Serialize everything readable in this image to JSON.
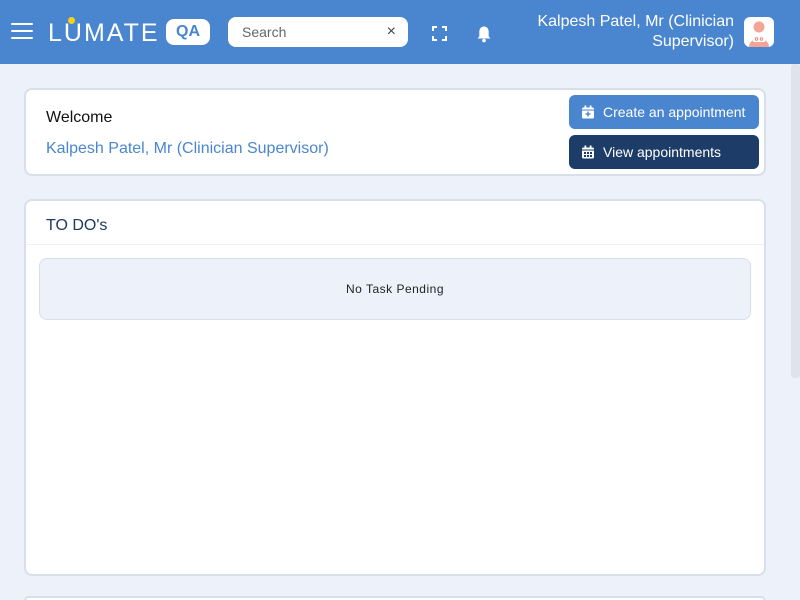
{
  "header": {
    "logo_text": "LUMATE",
    "env_badge": "QA",
    "search": {
      "placeholder": "Search",
      "value": ""
    },
    "clear_icon": "×",
    "user_name": "Kalpesh Patel, Mr (Clinician Supervisor)",
    "icons": [
      "menu-icon",
      "fullscreen-icon",
      "bell-icon",
      "clear-icon",
      "avatar"
    ],
    "colors": {
      "bar": "#4a86cf",
      "logo_dot": "#f7d117"
    }
  },
  "welcome": {
    "title": "Welcome",
    "user": "Kalpesh Patel, Mr (Clinician Supervisor)",
    "create_label": "Create an appointment",
    "view_label": "View appointments",
    "icons": [
      "calendar-plus-icon",
      "calendar-icon"
    ],
    "colors": {
      "create_button": "#4a86cf",
      "view_button": "#1d3c67"
    }
  },
  "todo": {
    "title": "TO DO's",
    "empty_message": "No Task Pending"
  }
}
